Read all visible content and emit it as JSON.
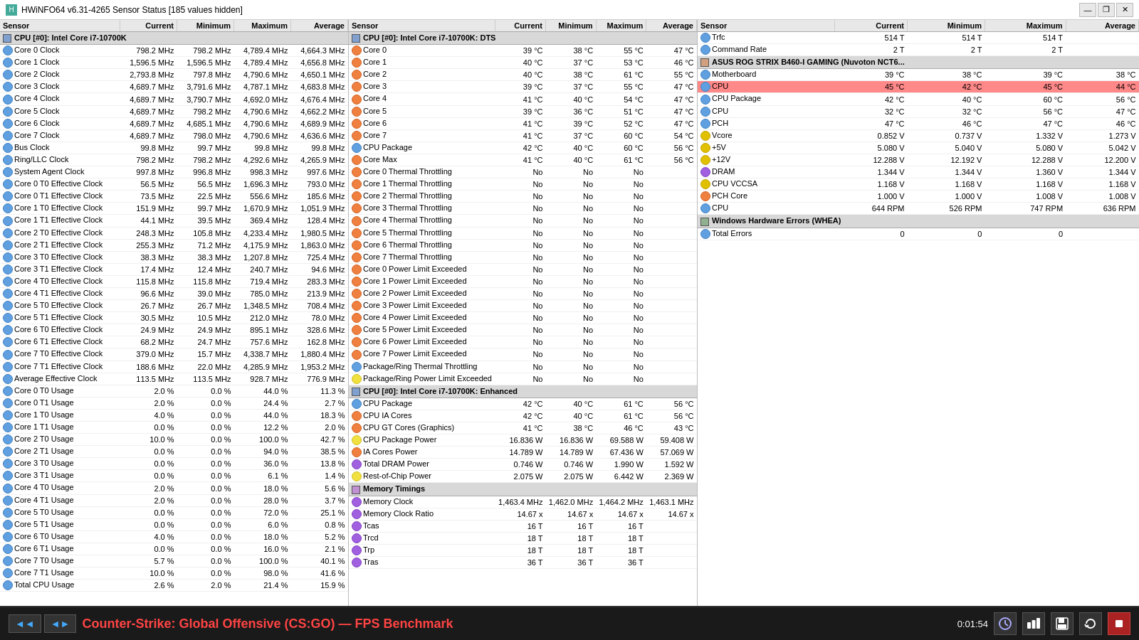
{
  "titleBar": {
    "title": "HWiNFO64 v6.31-4265 Sensor Status [185 values hidden]",
    "controls": [
      "—",
      "❐",
      "✕"
    ]
  },
  "panel1": {
    "headers": [
      "Sensor",
      "Current",
      "Minimum",
      "Maximum",
      "Average"
    ],
    "groups": [
      {
        "label": "CPU [#0]: Intel Core i7-10700K",
        "type": "cpu",
        "rows": [
          [
            "Core 0 Clock",
            "798.2 MHz",
            "798.2 MHz",
            "4,789.4 MHz",
            "4,664.3 MHz"
          ],
          [
            "Core 1 Clock",
            "1,596.5 MHz",
            "1,596.5 MHz",
            "4,789.4 MHz",
            "4,656.8 MHz"
          ],
          [
            "Core 2 Clock",
            "2,793.8 MHz",
            "797.8 MHz",
            "4,790.6 MHz",
            "4,650.1 MHz"
          ],
          [
            "Core 3 Clock",
            "4,689.7 MHz",
            "3,791.6 MHz",
            "4,787.1 MHz",
            "4,683.8 MHz"
          ],
          [
            "Core 4 Clock",
            "4,689.7 MHz",
            "3,790.7 MHz",
            "4,692.0 MHz",
            "4,676.4 MHz"
          ],
          [
            "Core 5 Clock",
            "4,689.7 MHz",
            "798.2 MHz",
            "4,790.6 MHz",
            "4,662.2 MHz"
          ],
          [
            "Core 6 Clock",
            "4,689.7 MHz",
            "4,685.1 MHz",
            "4,790.6 MHz",
            "4,689.9 MHz"
          ],
          [
            "Core 7 Clock",
            "4,689.7 MHz",
            "798.0 MHz",
            "4,790.6 MHz",
            "4,636.6 MHz"
          ],
          [
            "Bus Clock",
            "99.8 MHz",
            "99.7 MHz",
            "99.8 MHz",
            "99.8 MHz"
          ],
          [
            "Ring/LLC Clock",
            "798.2 MHz",
            "798.2 MHz",
            "4,292.6 MHz",
            "4,265.9 MHz"
          ],
          [
            "System Agent Clock",
            "997.8 MHz",
            "996.8 MHz",
            "998.3 MHz",
            "997.6 MHz"
          ],
          [
            "Core 0 T0 Effective Clock",
            "56.5 MHz",
            "56.5 MHz",
            "1,696.3 MHz",
            "793.0 MHz"
          ],
          [
            "Core 0 T1 Effective Clock",
            "73.5 MHz",
            "22.5 MHz",
            "556.6 MHz",
            "185.6 MHz"
          ],
          [
            "Core 1 T0 Effective Clock",
            "151.9 MHz",
            "99.7 MHz",
            "1,670.9 MHz",
            "1,051.9 MHz"
          ],
          [
            "Core 1 T1 Effective Clock",
            "44.1 MHz",
            "39.5 MHz",
            "369.4 MHz",
            "128.4 MHz"
          ],
          [
            "Core 2 T0 Effective Clock",
            "248.3 MHz",
            "105.8 MHz",
            "4,233.4 MHz",
            "1,980.5 MHz"
          ],
          [
            "Core 2 T1 Effective Clock",
            "255.3 MHz",
            "71.2 MHz",
            "4,175.9 MHz",
            "1,863.0 MHz"
          ],
          [
            "Core 3 T0 Effective Clock",
            "38.3 MHz",
            "38.3 MHz",
            "1,207.8 MHz",
            "725.4 MHz"
          ],
          [
            "Core 3 T1 Effective Clock",
            "17.4 MHz",
            "12.4 MHz",
            "240.7 MHz",
            "94.6 MHz"
          ],
          [
            "Core 4 T0 Effective Clock",
            "115.8 MHz",
            "115.8 MHz",
            "719.4 MHz",
            "283.3 MHz"
          ],
          [
            "Core 4 T1 Effective Clock",
            "96.6 MHz",
            "39.0 MHz",
            "785.0 MHz",
            "213.9 MHz"
          ],
          [
            "Core 5 T0 Effective Clock",
            "26.7 MHz",
            "26.7 MHz",
            "1,348.5 MHz",
            "708.4 MHz"
          ],
          [
            "Core 5 T1 Effective Clock",
            "30.5 MHz",
            "10.5 MHz",
            "212.0 MHz",
            "78.0 MHz"
          ],
          [
            "Core 6 T0 Effective Clock",
            "24.9 MHz",
            "24.9 MHz",
            "895.1 MHz",
            "328.6 MHz"
          ],
          [
            "Core 6 T1 Effective Clock",
            "68.2 MHz",
            "24.7 MHz",
            "757.6 MHz",
            "162.8 MHz"
          ],
          [
            "Core 7 T0 Effective Clock",
            "379.0 MHz",
            "15.7 MHz",
            "4,338.7 MHz",
            "1,880.4 MHz"
          ],
          [
            "Core 7 T1 Effective Clock",
            "188.6 MHz",
            "22.0 MHz",
            "4,285.9 MHz",
            "1,953.2 MHz"
          ],
          [
            "Average Effective Clock",
            "113.5 MHz",
            "113.5 MHz",
            "928.7 MHz",
            "776.9 MHz"
          ],
          [
            "Core 0 T0 Usage",
            "2.0 %",
            "0.0 %",
            "44.0 %",
            "11.3 %"
          ],
          [
            "Core 0 T1 Usage",
            "2.0 %",
            "0.0 %",
            "24.4 %",
            "2.7 %"
          ],
          [
            "Core 1 T0 Usage",
            "4.0 %",
            "0.0 %",
            "44.0 %",
            "18.3 %"
          ],
          [
            "Core 1 T1 Usage",
            "0.0 %",
            "0.0 %",
            "12.2 %",
            "2.0 %"
          ],
          [
            "Core 2 T0 Usage",
            "10.0 %",
            "0.0 %",
            "100.0 %",
            "42.7 %"
          ],
          [
            "Core 2 T1 Usage",
            "0.0 %",
            "0.0 %",
            "94.0 %",
            "38.5 %"
          ],
          [
            "Core 3 T0 Usage",
            "0.0 %",
            "0.0 %",
            "36.0 %",
            "13.8 %"
          ],
          [
            "Core 3 T1 Usage",
            "0.0 %",
            "0.0 %",
            "6.1 %",
            "1.4 %"
          ],
          [
            "Core 4 T0 Usage",
            "2.0 %",
            "0.0 %",
            "18.0 %",
            "5.6 %"
          ],
          [
            "Core 4 T1 Usage",
            "2.0 %",
            "0.0 %",
            "28.0 %",
            "3.7 %"
          ],
          [
            "Core 5 T0 Usage",
            "0.0 %",
            "0.0 %",
            "72.0 %",
            "25.1 %"
          ],
          [
            "Core 5 T1 Usage",
            "0.0 %",
            "0.0 %",
            "6.0 %",
            "0.8 %"
          ],
          [
            "Core 6 T0 Usage",
            "4.0 %",
            "0.0 %",
            "18.0 %",
            "5.2 %"
          ],
          [
            "Core 6 T1 Usage",
            "0.0 %",
            "0.0 %",
            "16.0 %",
            "2.1 %"
          ],
          [
            "Core 7 T0 Usage",
            "5.7 %",
            "0.0 %",
            "100.0 %",
            "40.1 %"
          ],
          [
            "Core 7 T1 Usage",
            "10.0 %",
            "0.0 %",
            "98.0 %",
            "41.6 %"
          ],
          [
            "Total CPU Usage",
            "2.6 %",
            "2.0 %",
            "21.4 %",
            "15.9 %"
          ]
        ]
      }
    ]
  },
  "panel2": {
    "headers": [
      "Sensor",
      "Current",
      "Minimum",
      "Maximum",
      "Average"
    ],
    "groups": [
      {
        "label": "CPU [#0]: Intel Core i7-10700K: DTS",
        "type": "cpu",
        "rows": [
          [
            "Core 0",
            "39 °C",
            "38 °C",
            "55 °C",
            "47 °C"
          ],
          [
            "Core 1",
            "40 °C",
            "37 °C",
            "53 °C",
            "46 °C"
          ],
          [
            "Core 2",
            "40 °C",
            "38 °C",
            "61 °C",
            "55 °C"
          ],
          [
            "Core 3",
            "39 °C",
            "37 °C",
            "55 °C",
            "47 °C"
          ],
          [
            "Core 4",
            "41 °C",
            "40 °C",
            "54 °C",
            "47 °C"
          ],
          [
            "Core 5",
            "39 °C",
            "36 °C",
            "51 °C",
            "47 °C"
          ],
          [
            "Core 6",
            "41 °C",
            "39 °C",
            "52 °C",
            "47 °C"
          ],
          [
            "Core 7",
            "41 °C",
            "37 °C",
            "60 °C",
            "54 °C"
          ],
          [
            "CPU Package",
            "42 °C",
            "40 °C",
            "60 °C",
            "56 °C"
          ],
          [
            "Core Max",
            "41 °C",
            "40 °C",
            "61 °C",
            "56 °C"
          ],
          [
            "Core 0 Thermal Throttling",
            "No",
            "No",
            "No",
            ""
          ],
          [
            "Core 1 Thermal Throttling",
            "No",
            "No",
            "No",
            ""
          ],
          [
            "Core 2 Thermal Throttling",
            "No",
            "No",
            "No",
            ""
          ],
          [
            "Core 3 Thermal Throttling",
            "No",
            "No",
            "No",
            ""
          ],
          [
            "Core 4 Thermal Throttling",
            "No",
            "No",
            "No",
            ""
          ],
          [
            "Core 5 Thermal Throttling",
            "No",
            "No",
            "No",
            ""
          ],
          [
            "Core 6 Thermal Throttling",
            "No",
            "No",
            "No",
            ""
          ],
          [
            "Core 7 Thermal Throttling",
            "No",
            "No",
            "No",
            ""
          ],
          [
            "Core 0 Power Limit Exceeded",
            "No",
            "No",
            "No",
            ""
          ],
          [
            "Core 1 Power Limit Exceeded",
            "No",
            "No",
            "No",
            ""
          ],
          [
            "Core 2 Power Limit Exceeded",
            "No",
            "No",
            "No",
            ""
          ],
          [
            "Core 3 Power Limit Exceeded",
            "No",
            "No",
            "No",
            ""
          ],
          [
            "Core 4 Power Limit Exceeded",
            "No",
            "No",
            "No",
            ""
          ],
          [
            "Core 5 Power Limit Exceeded",
            "No",
            "No",
            "No",
            ""
          ],
          [
            "Core 6 Power Limit Exceeded",
            "No",
            "No",
            "No",
            ""
          ],
          [
            "Core 7 Power Limit Exceeded",
            "No",
            "No",
            "No",
            ""
          ],
          [
            "Package/Ring Thermal Throttling",
            "No",
            "No",
            "No",
            ""
          ],
          [
            "Package/Ring Power Limit Exceeded",
            "No",
            "No",
            "No",
            ""
          ]
        ]
      },
      {
        "label": "CPU [#0]: Intel Core i7-10700K: Enhanced",
        "type": "cpu_enhanced",
        "rows": [
          [
            "CPU Package",
            "42 °C",
            "40 °C",
            "61 °C",
            "56 °C"
          ],
          [
            "CPU IA Cores",
            "42 °C",
            "40 °C",
            "61 °C",
            "56 °C"
          ],
          [
            "CPU GT Cores (Graphics)",
            "41 °C",
            "38 °C",
            "46 °C",
            "43 °C"
          ],
          [
            "CPU Package Power",
            "16.836 W",
            "16.836 W",
            "69.588 W",
            "59.408 W"
          ],
          [
            "IA Cores Power",
            "14.789 W",
            "14.789 W",
            "67.436 W",
            "57.069 W"
          ],
          [
            "Total DRAM Power",
            "0.746 W",
            "0.746 W",
            "1.990 W",
            "1.592 W"
          ],
          [
            "Rest-of-Chip Power",
            "2.075 W",
            "2.075 W",
            "6.442 W",
            "2.369 W"
          ]
        ]
      },
      {
        "label": "Memory Timings",
        "type": "mem",
        "rows": [
          [
            "Memory Clock",
            "1,463.4 MHz",
            "1,462.0 MHz",
            "1,464.2 MHz",
            "1,463.1 MHz"
          ],
          [
            "Memory Clock Ratio",
            "14.67 x",
            "14.67 x",
            "14.67 x",
            "14.67 x"
          ],
          [
            "Tcas",
            "16 T",
            "16 T",
            "16 T",
            ""
          ],
          [
            "Trcd",
            "18 T",
            "18 T",
            "18 T",
            ""
          ],
          [
            "Trp",
            "18 T",
            "18 T",
            "18 T",
            ""
          ],
          [
            "Tras",
            "36 T",
            "36 T",
            "36 T",
            ""
          ]
        ]
      }
    ]
  },
  "panel3": {
    "headers": [
      "Sensor",
      "Current",
      "Minimum",
      "Maximum",
      "Average"
    ],
    "groups": [
      {
        "label": "",
        "type": "plain",
        "rows": [
          [
            "Trfc",
            "514 T",
            "514 T",
            "514 T",
            ""
          ],
          [
            "Command Rate",
            "2 T",
            "2 T",
            "2 T",
            ""
          ]
        ]
      },
      {
        "label": "ASUS ROG STRIX B460-I GAMING (Nuvoton NCT6...",
        "type": "asus",
        "rows": [
          [
            "Motherboard",
            "39 °C",
            "38 °C",
            "39 °C",
            "38 °C"
          ],
          [
            "CPU",
            "45 °C",
            "42 °C",
            "45 °C",
            "44 °C",
            "highlight"
          ],
          [
            "CPU Package",
            "42 °C",
            "40 °C",
            "60 °C",
            "56 °C"
          ],
          [
            "CPU",
            "32 °C",
            "32 °C",
            "56 °C",
            "47 °C"
          ],
          [
            "PCH",
            "47 °C",
            "46 °C",
            "47 °C",
            "46 °C"
          ],
          [
            "Vcore",
            "0.852 V",
            "0.737 V",
            "1.332 V",
            "1.273 V"
          ],
          [
            "+5V",
            "5.080 V",
            "5.040 V",
            "5.080 V",
            "5.042 V"
          ],
          [
            "+12V",
            "12.288 V",
            "12.192 V",
            "12.288 V",
            "12.200 V"
          ],
          [
            "DRAM",
            "1.344 V",
            "1.344 V",
            "1.360 V",
            "1.344 V"
          ],
          [
            "CPU VCCSA",
            "1.168 V",
            "1.168 V",
            "1.168 V",
            "1.168 V"
          ],
          [
            "PCH Core",
            "1.000 V",
            "1.000 V",
            "1.008 V",
            "1.008 V"
          ],
          [
            "CPU",
            "644 RPM",
            "526 RPM",
            "747 RPM",
            "636 RPM"
          ]
        ]
      },
      {
        "label": "Windows Hardware Errors (WHEA)",
        "type": "whea",
        "rows": [
          [
            "Total Errors",
            "0",
            "0",
            "0",
            ""
          ]
        ]
      }
    ]
  },
  "statusBar": {
    "leftArrows": [
      "◄◄",
      "◄►"
    ],
    "label": "Counter-Strike: Global Offensive (CS:GO) — FPS Benchmark",
    "time": "0:01:54",
    "rightIcons": [
      "🖧",
      "⏱",
      "📋",
      "🔄",
      "✕"
    ]
  }
}
